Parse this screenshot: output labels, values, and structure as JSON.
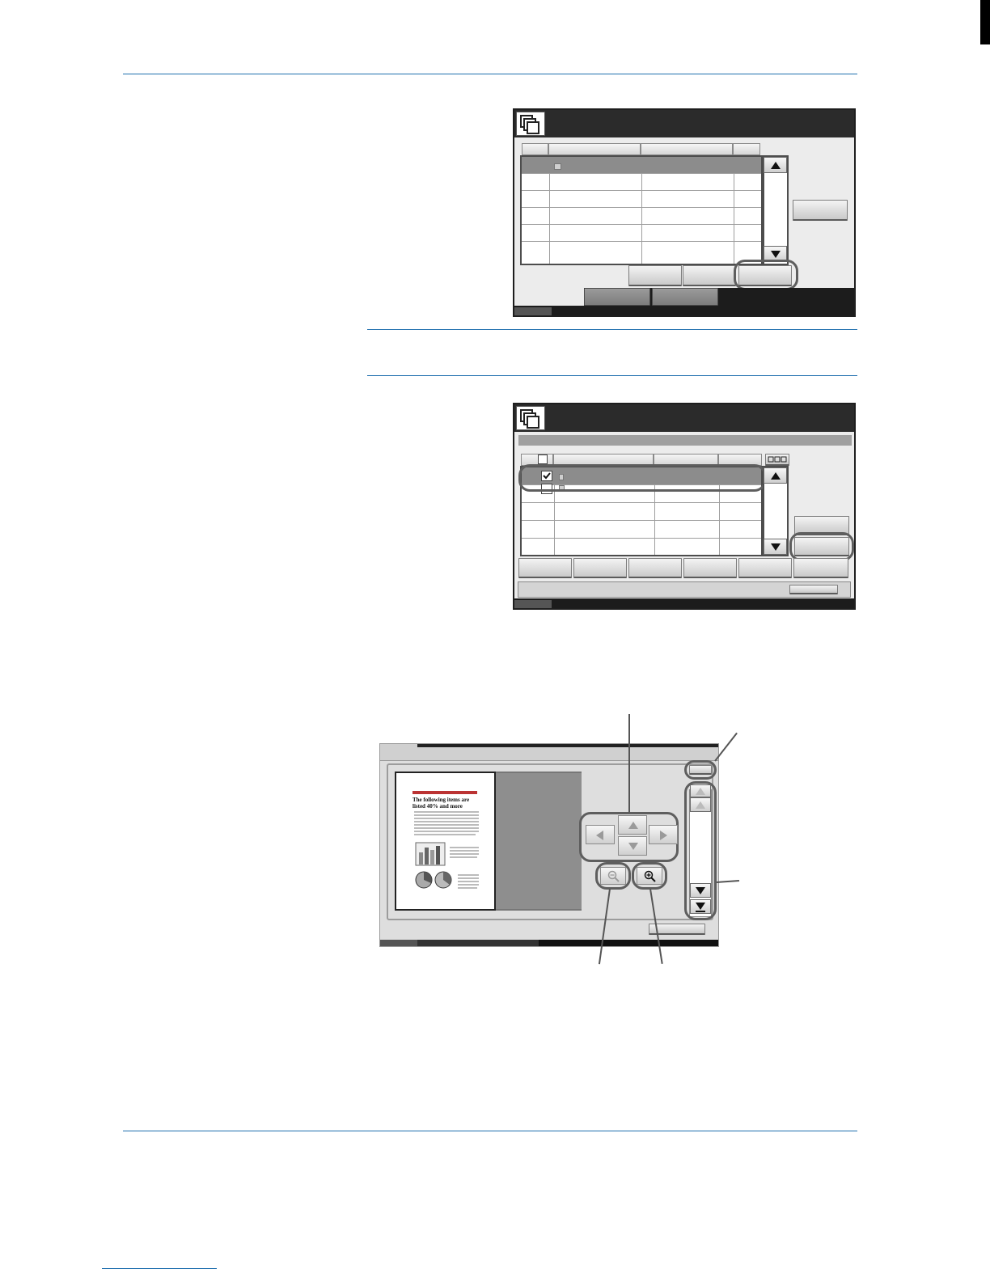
{
  "page": {
    "rules": [
      "top-rule",
      "note-rule-top",
      "note-rule-bottom",
      "bottom-rule"
    ]
  },
  "figures": [
    {
      "name": "document-box-list-screen",
      "caption": ""
    },
    {
      "name": "document-select-screen",
      "caption": ""
    },
    {
      "name": "preview-screen",
      "caption": ""
    }
  ],
  "preview": {
    "document_thumbnail": {
      "heading": "The following items are",
      "heading_line2": "listed 40% and more"
    },
    "controls": [
      "scroll-left",
      "scroll-up",
      "scroll-right",
      "scroll-down",
      "zoom-out",
      "zoom-in",
      "close",
      "page-first",
      "page-prev",
      "page-next",
      "page-last"
    ]
  },
  "colors": {
    "rule": "#1f6fae",
    "panel_dark": "#2b2b2b",
    "highlight_row": "#8c8c8c",
    "callout": "#5e5e5e"
  }
}
